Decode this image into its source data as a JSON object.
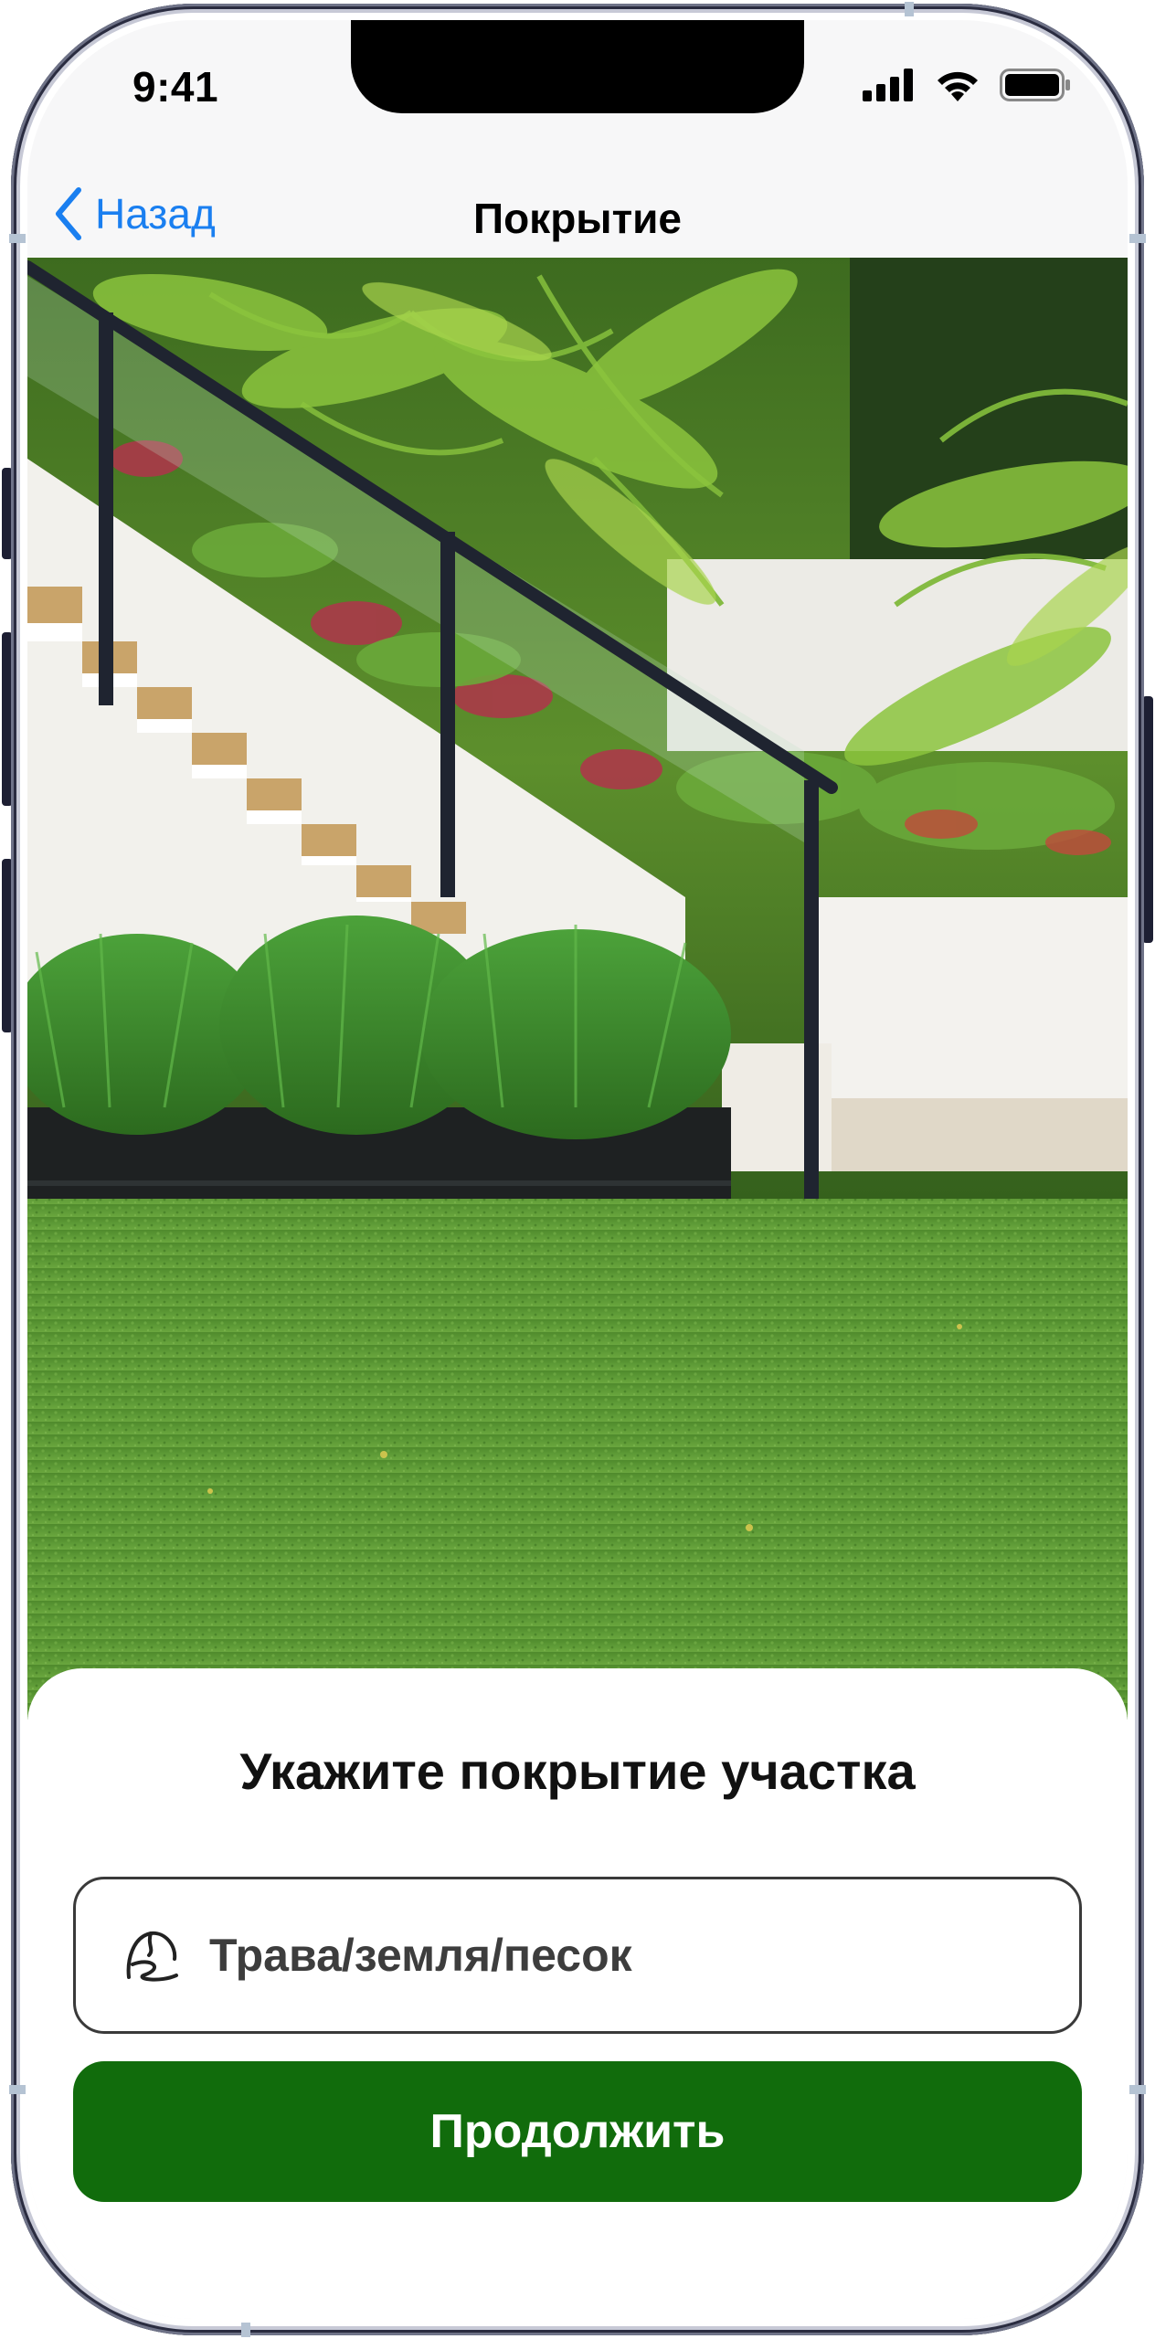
{
  "status_bar": {
    "time": "9:41",
    "icons": [
      "cellular-signal-icon",
      "wifi-icon",
      "battery-icon"
    ]
  },
  "nav": {
    "back_label": "Назад",
    "title": "Покрытие"
  },
  "photo": {
    "subject": "garden-staircase-with-artificial-grass-photo"
  },
  "sheet": {
    "title": "Укажите покрытие участка",
    "field_value": "Трава/земля/песок",
    "field_icon": "terrain-icon",
    "continue_label": "Продолжить"
  },
  "colors": {
    "accent_blue": "#1a7ff0",
    "primary_green": "#116c0c",
    "phone_frame": "#2a2c40"
  }
}
